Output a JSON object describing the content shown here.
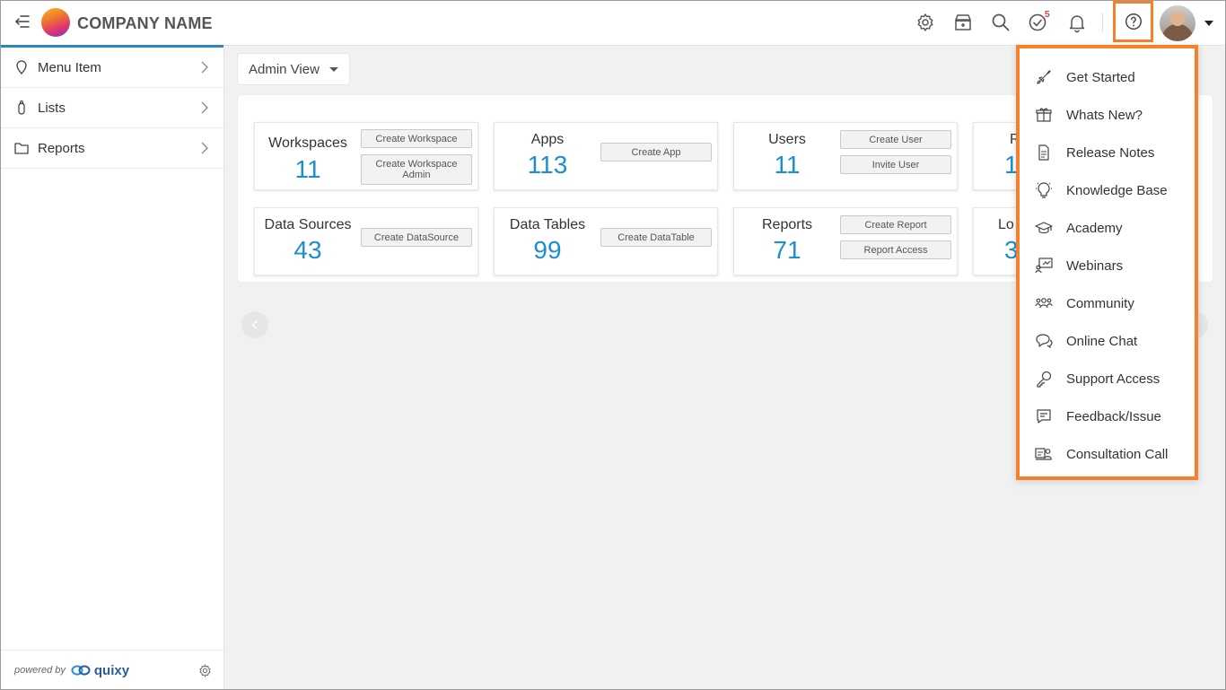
{
  "header": {
    "company_name": "COMPANY NAME",
    "notification_badge": "5",
    "icons": [
      "collapse-menu-icon",
      "gear-icon",
      "store-icon",
      "search-icon",
      "tasks-check-icon",
      "bell-icon",
      "help-icon"
    ]
  },
  "sidebar": {
    "items": [
      {
        "label": "Menu Item",
        "icon": "location-pin-icon"
      },
      {
        "label": "Lists",
        "icon": "list-icon"
      },
      {
        "label": "Reports",
        "icon": "folder-icon"
      }
    ],
    "footer": {
      "powered_by": "powered by",
      "brand": "quixy"
    }
  },
  "main": {
    "view_selector": "Admin View",
    "cards": [
      {
        "title": "Workspaces",
        "count": "11",
        "buttons": [
          "Create Workspace",
          "Create Workspace Admin"
        ]
      },
      {
        "title": "Apps",
        "count": "113",
        "buttons": [
          "Create App"
        ]
      },
      {
        "title": "Users",
        "count": "11",
        "buttons": [
          "Create User",
          "Invite User"
        ]
      },
      {
        "title": "R",
        "count": "1"
      },
      {
        "title": "Data Sources",
        "count": "43",
        "buttons": [
          "Create DataSource"
        ]
      },
      {
        "title": "Data Tables",
        "count": "99",
        "buttons": [
          "Create DataTable"
        ]
      },
      {
        "title": "Reports",
        "count": "71",
        "buttons": [
          "Create Report",
          "Report Access"
        ]
      },
      {
        "title": "Lo",
        "count": "3"
      }
    ]
  },
  "help_menu": {
    "items": [
      {
        "label": "Get Started",
        "icon": "rocket-icon"
      },
      {
        "label": "Whats New?",
        "icon": "gift-icon"
      },
      {
        "label": "Release Notes",
        "icon": "document-icon"
      },
      {
        "label": "Knowledge Base",
        "icon": "lightbulb-icon"
      },
      {
        "label": "Academy",
        "icon": "graduation-cap-icon"
      },
      {
        "label": "Webinars",
        "icon": "presentation-icon"
      },
      {
        "label": "Community",
        "icon": "community-icon"
      },
      {
        "label": "Online Chat",
        "icon": "chat-icon"
      },
      {
        "label": "Support Access",
        "icon": "key-icon"
      },
      {
        "label": "Feedback/Issue",
        "icon": "feedback-icon"
      },
      {
        "label": "Consultation Call",
        "icon": "consultation-icon"
      }
    ]
  },
  "colors": {
    "accent_orange": "#f5822a",
    "count_blue": "#1b8fcf",
    "sidebar_accent": "#2e86c1"
  }
}
